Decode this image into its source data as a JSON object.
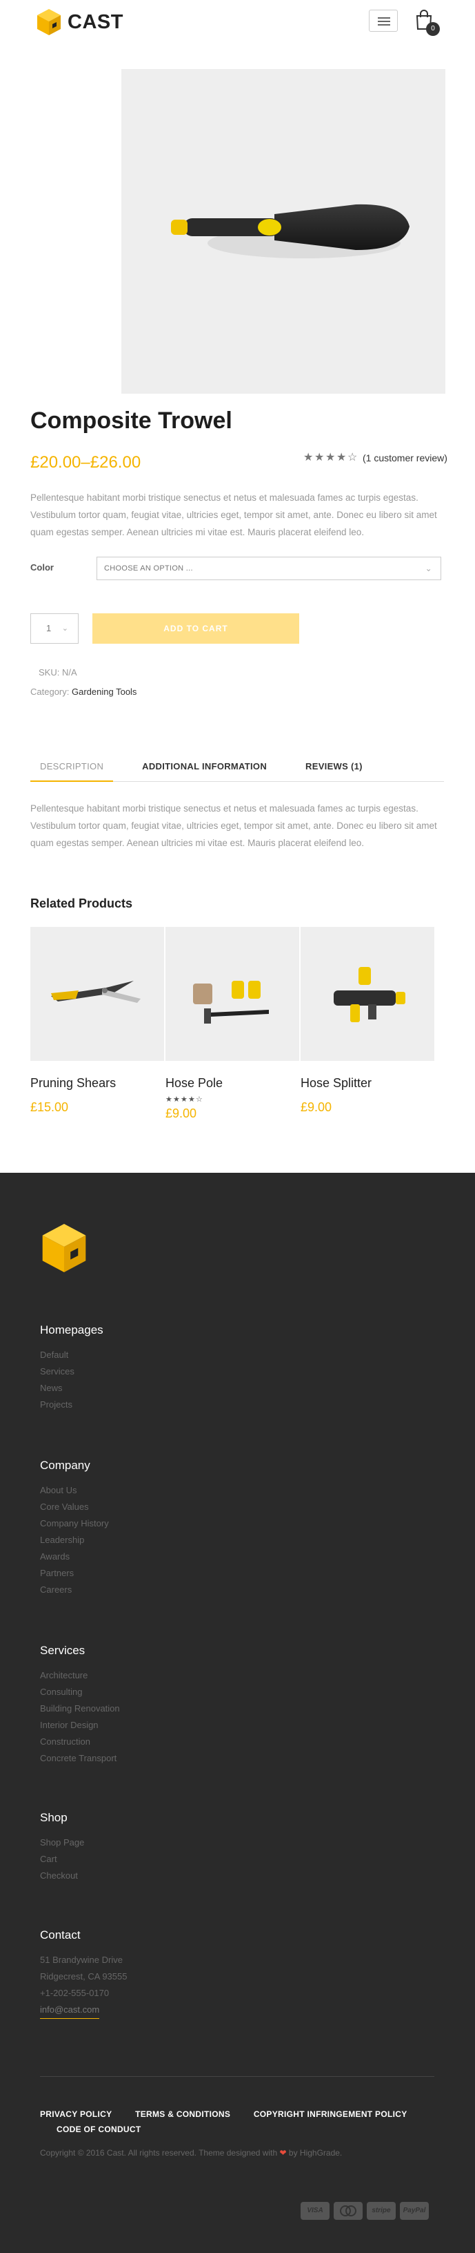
{
  "header": {
    "logo_text": "CAST",
    "cart_count": "0"
  },
  "product": {
    "title": "Composite Trowel",
    "price": "£20.00–£26.00",
    "rating": 4,
    "reviews_link": "(1 customer review)",
    "description": "Pellentesque habitant morbi tristique senectus et netus et malesuada fames ac turpis egestas. Vestibulum tortor quam, feugiat vitae, ultricies eget, tempor sit amet, ante. Donec eu libero sit amet quam egestas semper. Aenean ultricies mi vitae est. Mauris placerat eleifend leo.",
    "color_label": "Color",
    "color_placeholder": "CHOOSE AN OPTION ...",
    "quantity": "1",
    "add_to_cart": "ADD TO CART",
    "sku": "SKU: N/A",
    "category_label": "Category:",
    "category_value": "Gardening Tools"
  },
  "tabs": [
    {
      "label": "DESCRIPTION",
      "active": true
    },
    {
      "label": "ADDITIONAL INFORMATION",
      "active": false
    },
    {
      "label": "REVIEWS (1)",
      "active": false
    }
  ],
  "tab_body": "Pellentesque habitant morbi tristique senectus et netus et malesuada fames ac turpis egestas. Vestibulum tortor quam, feugiat vitae, ultricies eget, tempor sit amet, ante. Donec eu libero sit amet quam egestas semper. Aenean ultricies mi vitae est. Mauris placerat eleifend leo.",
  "related": {
    "title": "Related Products",
    "items": [
      {
        "name": "Pruning Shears",
        "price": "£15.00",
        "rating": 0
      },
      {
        "name": "Hose Pole",
        "price": "£9.00",
        "rating": 4
      },
      {
        "name": "Hose Splitter",
        "price": "£9.00",
        "rating": 0
      }
    ]
  },
  "footer": {
    "sections": [
      {
        "title": "Homepages",
        "links": [
          "Default",
          "Services",
          "News",
          "Projects"
        ]
      },
      {
        "title": "Company",
        "links": [
          "About Us",
          "Core Values",
          "Company History",
          "Leadership",
          "Awards",
          "Partners",
          "Careers"
        ]
      },
      {
        "title": "Services",
        "links": [
          "Architecture",
          "Consulting",
          "Building Renovation",
          "Interior Design",
          "Construction",
          "Concrete Transport"
        ]
      },
      {
        "title": "Shop",
        "links": [
          "Shop Page",
          "Cart",
          "Checkout"
        ]
      },
      {
        "title": "Contact",
        "links": [
          "51 Brandywine Drive",
          "Ridgecrest, CA 93555",
          "+1-202-555-0170"
        ],
        "email": "info@cast.com"
      }
    ],
    "legal": [
      "PRIVACY POLICY",
      "TERMS & CONDITIONS",
      "COPYRIGHT INFRINGEMENT POLICY",
      "CODE OF CONDUCT"
    ],
    "copyright_before": "Copyright © 2016 Cast. All rights reserved. Theme designed with",
    "copyright_after": "by HighGrade.",
    "payments": [
      "VISA",
      "MC",
      "stripe",
      "PayPal"
    ]
  },
  "colors": {
    "accent": "#f5b400",
    "footer_bg": "#2a2a2a",
    "button_light": "#ffe08a"
  }
}
